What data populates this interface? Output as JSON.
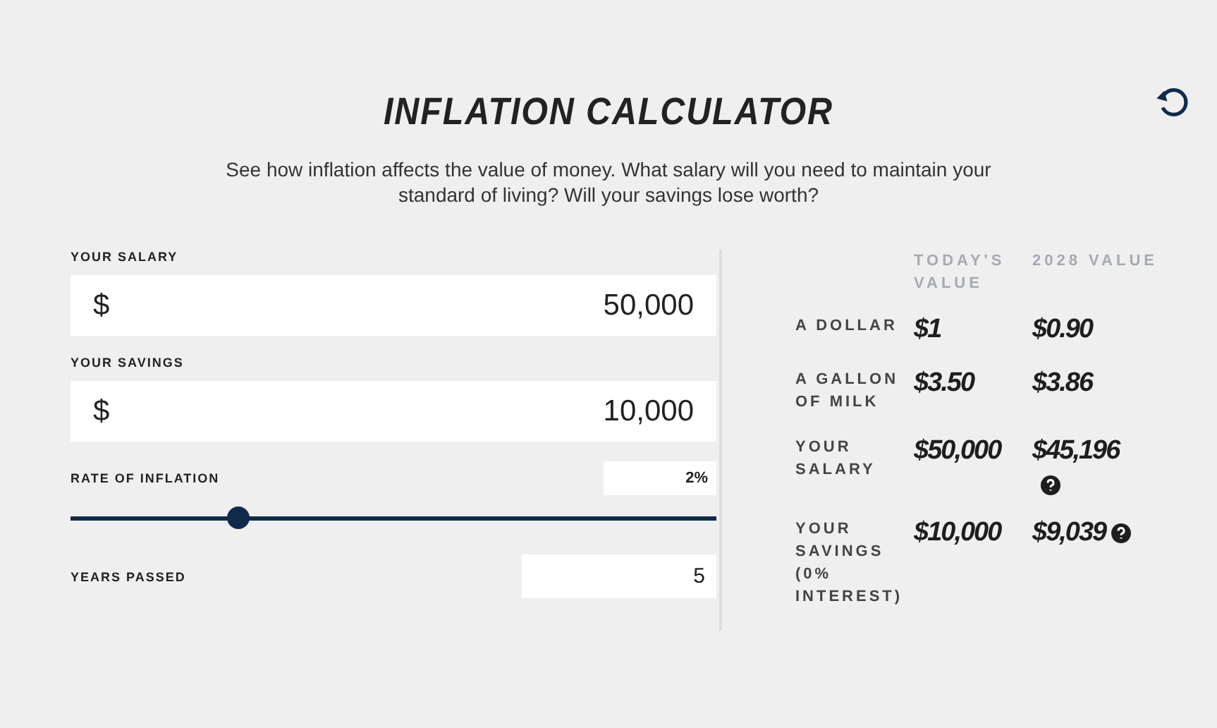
{
  "title": "INFLATION CALCULATOR",
  "intro": "See how inflation affects the value of money. What salary will you need to maintain your standard of living? Will your savings lose worth?",
  "inputs": [
    {
      "label": "YOUR SALARY",
      "prefix": "$",
      "value": "50,000"
    },
    {
      "label": "YOUR SAVINGS",
      "prefix": "$",
      "value": "10,000"
    }
  ],
  "rate": {
    "label": "RATE OF INFLATION",
    "value": "2%",
    "level": 0.26
  },
  "years": {
    "label": "YEARS PASSED",
    "value": "5"
  },
  "results": {
    "columns": [
      "TODAY'S VALUE",
      "2028 VALUE"
    ],
    "rows": [
      {
        "label": "A DOLLAR",
        "today": "$1",
        "future": "$0.90",
        "help": false
      },
      {
        "label": "A GALLON OF MILK",
        "today": "$3.50",
        "future": "$3.86",
        "help": false
      },
      {
        "label": "YOUR SALARY",
        "today": "$50,000",
        "future": "$45,196",
        "help": true
      },
      {
        "label": "YOUR SAVINGS (0% INTEREST)",
        "today": "$10,000",
        "future": "$9,039",
        "help": true
      }
    ]
  }
}
